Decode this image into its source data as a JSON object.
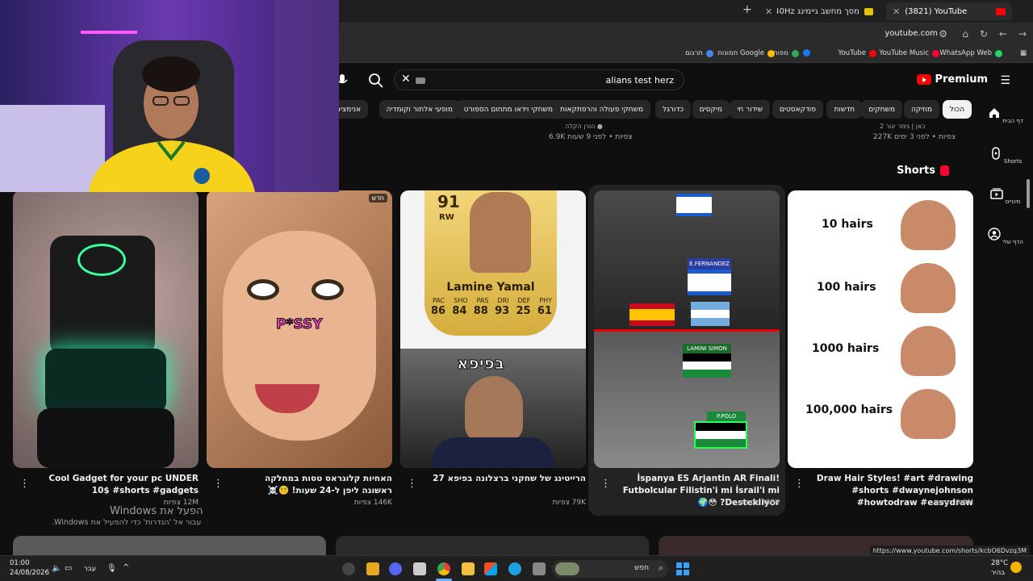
{
  "browser": {
    "tabs": [
      {
        "title": "(3821) YouTube",
        "active": true
      },
      {
        "title": "מסך מחשב גיימינג QHD 240Hz",
        "active": false
      }
    ],
    "new_tab": "+",
    "url": "youtube.com",
    "bookmarks": [
      "WhatsApp Web",
      "YouTube Music",
      "YouTube",
      "מפות",
      "תמונות Google",
      "תרגום"
    ]
  },
  "youtube": {
    "logo_text": "Premium",
    "search_value": "alians test herz",
    "chips": [
      "הכול",
      "מוזיקה",
      "משחקים",
      "חדשות",
      "פודקאסטים",
      "שידור חי",
      "מיקסים",
      "כדורגל",
      "משחקי פעולה והרפתקאות",
      "משחקי וידאו מתחום הספורט",
      "מופעי אלתור וקומדיה",
      "אנימציה"
    ],
    "sidebar": [
      {
        "label": "דף הבית",
        "icon": "home-icon"
      },
      {
        "label": "Shorts",
        "icon": "shorts-icon"
      },
      {
        "label": "מינויים",
        "icon": "subscriptions-icon"
      },
      {
        "label": "הדף שלי",
        "icon": "account-icon"
      }
    ],
    "prev_row": {
      "left_meta_top": "הורן הקלה ●",
      "left_meta": "6.9K צפיות • לפני 9 שעות",
      "right_meta_top": "כאן | גימר יגור 2",
      "right_meta": "227K צפיות • לפני 3 ימים"
    },
    "shorts_heading": "Shorts",
    "shorts": [
      {
        "title": "Draw Hair Styles! #art #drawing #shorts #dwaynejohnson #howtodraw #easydraw",
        "views": "6.6M צפיות",
        "thumb_lines": [
          "10 hairs",
          "100 hairs",
          "1000 hairs",
          "100,000 hairs"
        ]
      },
      {
        "title": "İspanya ES Arjantin AR Finali! Futbolcular Filistin'i mi İsrail'i mi Destekliyor? 😳🌍",
        "views": "388K צפיות",
        "thumb_labels": [
          "E.FERNANDEZ",
          "LAMINI SIMON",
          "P.POLO"
        ]
      },
      {
        "title": "הרייטינג של שחקני ברצלונה בפיפא 27",
        "views": "79K צפיות",
        "thumb_card": {
          "rating": "91",
          "position": "RW",
          "name": "Lamine Yamal",
          "stats_labels": [
            "PAC",
            "SHO",
            "PAS",
            "DRI",
            "DEF",
            "PHY"
          ],
          "stats_values": [
            "86",
            "84",
            "88",
            "93",
            "25",
            "61"
          ],
          "overlay": "בפיפא"
        }
      },
      {
        "title": "האחיות קלוגראס טסות במחלקה ראשונה ליפן ל-24 שעות! 😵‍💫☠️",
        "views": "146K צפיות",
        "badge": "חדש",
        "thumb_text": "P*SSY"
      },
      {
        "title": "Cool Gadget for your pc UNDER 10$ #shorts #gadgets",
        "views": "12M צפיות"
      }
    ]
  },
  "windows": {
    "activate_title": "הפעל את Windows",
    "activate_sub": "עבור אל 'הגדרות' כדי להפעיל את Windows.",
    "status_link": "https://www.youtube.com/shorts/kcbO6Dvzq3M",
    "taskbar_search": "חפש",
    "time": "01:00",
    "date": "24/08/2026",
    "lang": "עבר",
    "weather_temp": "28°C",
    "weather_desc": "בהיר"
  }
}
